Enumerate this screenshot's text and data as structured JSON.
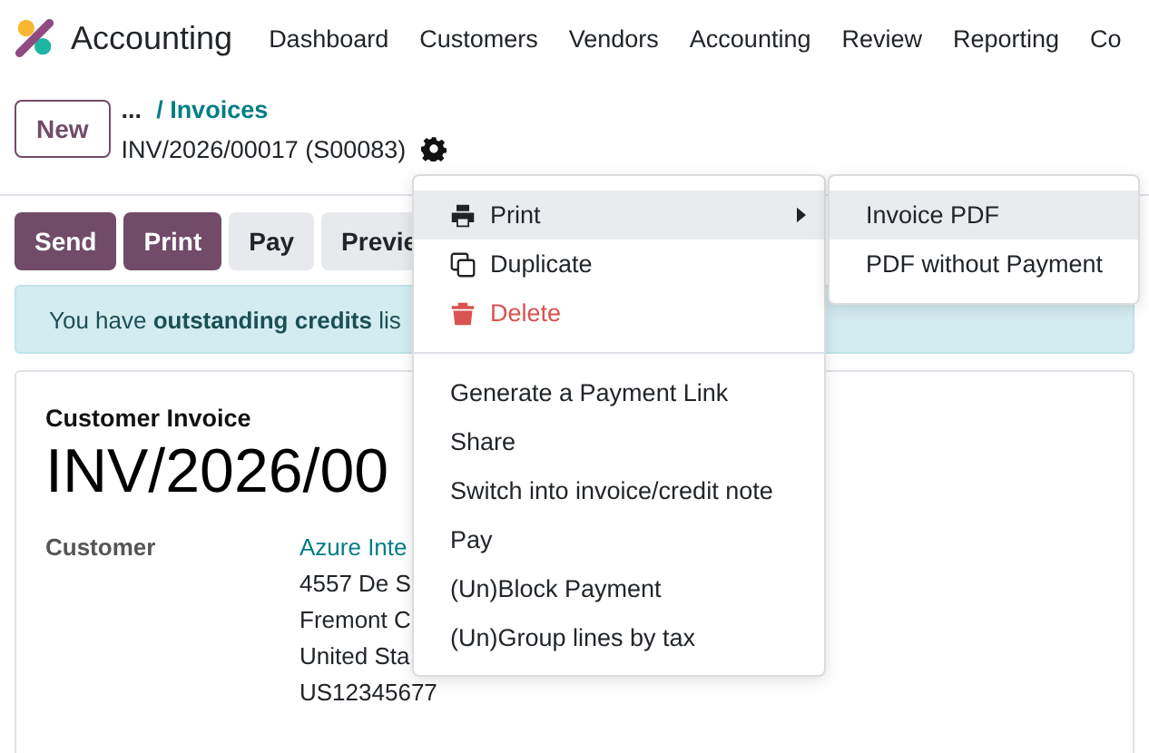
{
  "app": {
    "name": "Accounting"
  },
  "nav": [
    "Dashboard",
    "Customers",
    "Vendors",
    "Accounting",
    "Review",
    "Reporting",
    "Co"
  ],
  "control_panel": {
    "new_button": "New",
    "breadcrumb_more": "...",
    "breadcrumb_parent": "/ Invoices",
    "record_name": "INV/2026/00017 (S00083)"
  },
  "action_buttons": [
    {
      "label": "Send",
      "kind": "primary"
    },
    {
      "label": "Print",
      "kind": "primary"
    },
    {
      "label": "Pay",
      "kind": "secondary"
    },
    {
      "label": "Previe",
      "kind": "secondary"
    }
  ],
  "alert": "You have **outstanding credits** lis",
  "form": {
    "type_label": "Customer Invoice",
    "title": "INV/2026/00",
    "customer_label": "Customer",
    "customer_name": "Azure Inte",
    "address": [
      "4557 De S",
      "Fremont C",
      "United Sta",
      "US12345677"
    ]
  },
  "gear_menu": {
    "groups": [
      [
        {
          "label": "Print",
          "kind": "print",
          "selected": true,
          "submenu": true
        },
        {
          "label": "Duplicate",
          "kind": "duplicate",
          "selected": false,
          "submenu": false
        },
        {
          "label": "Delete",
          "kind": "delete",
          "selected": false,
          "submenu": false
        }
      ],
      [
        {
          "label": "Generate a Payment Link",
          "kind": "plain",
          "selected": false,
          "submenu": false
        },
        {
          "label": "Share",
          "kind": "plain",
          "selected": false,
          "submenu": false
        },
        {
          "label": "Switch into invoice/credit note",
          "kind": "plain",
          "selected": false,
          "submenu": false
        },
        {
          "label": "Pay",
          "kind": "plain",
          "selected": false,
          "submenu": false
        },
        {
          "label": "(Un)Block Payment",
          "kind": "plain",
          "selected": false,
          "submenu": false
        },
        {
          "label": "(Un)Group lines by tax",
          "kind": "plain",
          "selected": false,
          "submenu": false
        }
      ]
    ]
  },
  "print_submenu": [
    {
      "label": "Invoice PDF",
      "selected": true
    },
    {
      "label": "PDF without Payment",
      "selected": false
    }
  ]
}
